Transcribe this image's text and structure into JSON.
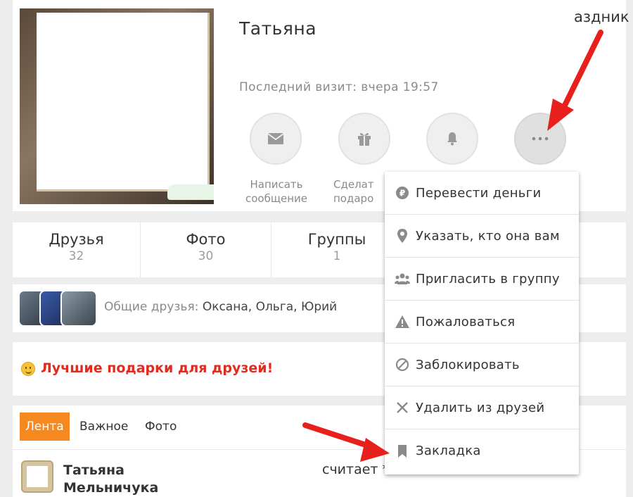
{
  "profile": {
    "name": "Татьяна",
    "last_visit": "Последний визит: вчера 19:57"
  },
  "actions": {
    "message_caption_line1": "Написать",
    "message_caption_line2": "сообщение",
    "gift_caption_line1": "Сделат",
    "gift_caption_line2": "подаро"
  },
  "stats": {
    "friends_label": "Друзья",
    "friends_count": "32",
    "photo_label": "Фото",
    "photo_count": "30",
    "groups_label": "Группы",
    "groups_count": "1",
    "holidays_label": "аздник"
  },
  "mutual": {
    "prefix": "Общие друзья: ",
    "names": "Оксана, Ольга, Юрий"
  },
  "promo": {
    "text": "Лучшие подарки для друзей!"
  },
  "feed": {
    "tabs": [
      "Лента",
      "Важное",
      "Фото"
    ],
    "post_author_line1": "Татьяна",
    "post_author_line2": "Мельничука",
    "post_action": "считает ****** ********** Мишан"
  },
  "menu": {
    "items": [
      {
        "label": "Перевести деньги",
        "icon": "money-icon"
      },
      {
        "label": "Указать, кто она вам",
        "icon": "location-pin-icon"
      },
      {
        "label": "Пригласить в группу",
        "icon": "group-icon"
      },
      {
        "label": "Пожаловаться",
        "icon": "warning-icon"
      },
      {
        "label": "Заблокировать",
        "icon": "block-icon"
      },
      {
        "label": "Удалить из друзей",
        "icon": "close-icon"
      },
      {
        "label": "Закладка",
        "icon": "bookmark-icon"
      }
    ]
  },
  "colors": {
    "accent_orange": "#f5891f",
    "promo_red": "#e22b1f",
    "arrow_red": "#e8201b"
  }
}
